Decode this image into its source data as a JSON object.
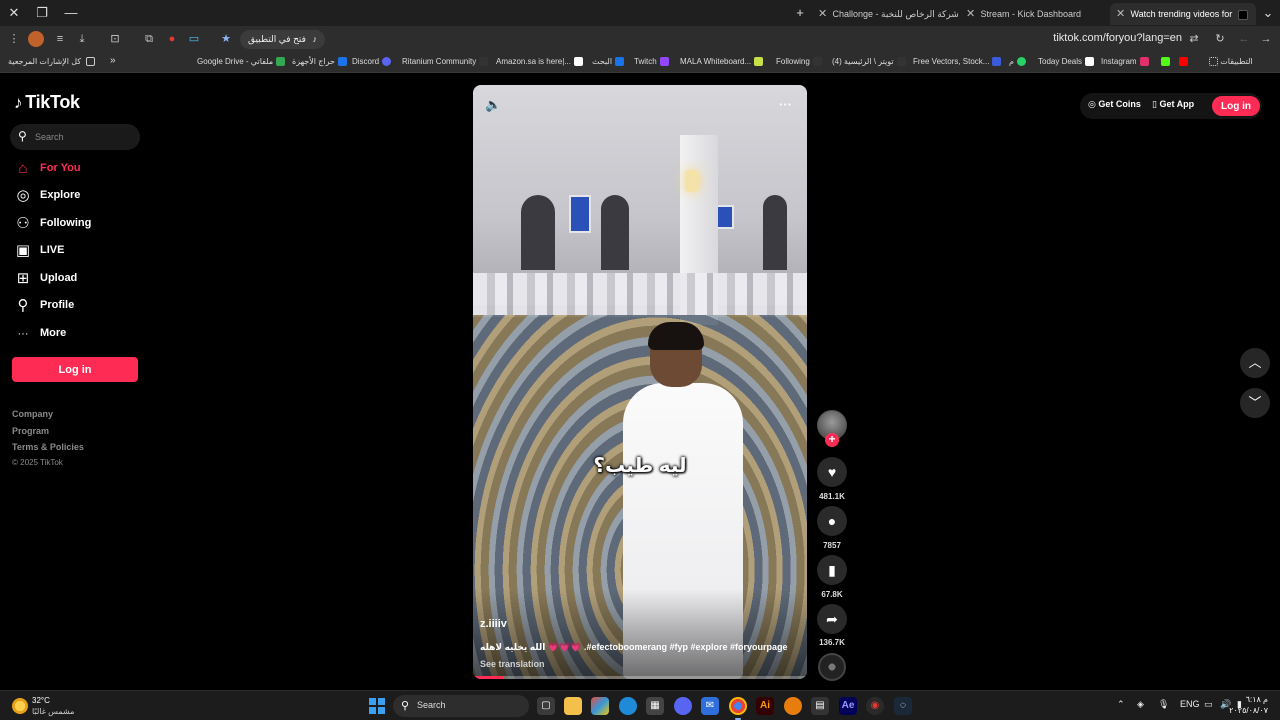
{
  "browser": {
    "tabs": [
      {
        "label": "Challonge - شركة الرخاص للنخبة"
      },
      {
        "label": "Stream - Kick Dashboard"
      },
      {
        "label": "Watch trending videos for"
      }
    ],
    "new_tab_symbol": "+",
    "open_in_app_label": "فتح في التطبيق",
    "url": "tiktok.com/foryou?lang=en",
    "all_bookmarks_label": "كل الإشارات المرجعية",
    "overflow_symbol": "»",
    "apps_label": "التطبيقات",
    "bookmarks": [
      {
        "label": "Google Drive - ملفاتي",
        "color": "#34a853"
      },
      {
        "label": "حراج الأجهزة",
        "color": "#1a73e8"
      },
      {
        "label": "Discord",
        "color": "#5865f2"
      },
      {
        "label": "Ritanium Community",
        "color": "#555555"
      },
      {
        "label": "Amazon.sa is here|...",
        "color": "#ff9900"
      },
      {
        "label": "البحث",
        "color": "#444444"
      },
      {
        "label": "Twitch",
        "color": "#9146ff"
      },
      {
        "label": "MALA Whiteboard...",
        "color": "#c8e04a"
      },
      {
        "label": "Following",
        "color": "#333333"
      },
      {
        "label": "(4) تويتر \\ الرئيسية",
        "color": "#333333"
      },
      {
        "label": "Free Vectors, Stock...",
        "color": "#3b5bdb"
      },
      {
        "label": "م",
        "color": "#25d366"
      },
      {
        "label": "Today Deals",
        "color": "#222222"
      },
      {
        "label": "Instagram",
        "color": "#e1306c"
      }
    ]
  },
  "tiktok": {
    "brand": "TikTok",
    "search_placeholder": "Search",
    "nav": [
      {
        "label": "For You",
        "icon": "home-icon",
        "glyph": "⌂",
        "active": true
      },
      {
        "label": "Explore",
        "icon": "compass-icon",
        "glyph": "◎",
        "active": false
      },
      {
        "label": "Following",
        "icon": "following-icon",
        "glyph": "⚇",
        "active": false
      },
      {
        "label": "LIVE",
        "icon": "live-icon",
        "glyph": "▣",
        "active": false
      },
      {
        "label": "Upload",
        "icon": "upload-icon",
        "glyph": "⊞",
        "active": false
      },
      {
        "label": "Profile",
        "icon": "profile-icon",
        "glyph": "⚲",
        "active": false
      },
      {
        "label": "More",
        "icon": "more-icon",
        "glyph": "···",
        "active": false
      }
    ],
    "login_label": "Log in",
    "footer_links": [
      "Company",
      "Program",
      "Terms & Policies"
    ],
    "copyright": "© 2025 TikTok",
    "top_right": {
      "coins_label": "Get Coins",
      "app_label": "Get App",
      "login_label": "Log in"
    },
    "video": {
      "overlay_caption": "ليه طيب؟",
      "username": "z.iiiiv",
      "description": "الله يخليه لاهله 💗💗💗 .#efectoboomerang #fyp #explore #foryourpage",
      "see_translation": "See translation",
      "progress": 0.09,
      "likes": "481.1K",
      "comments": "7857",
      "saves": "67.8K",
      "shares": "136.7K"
    }
  },
  "taskbar": {
    "weather_temp": "32°C",
    "weather_cond": "مشمس غالبًا",
    "search_label": "Search",
    "lang": "ENG",
    "time": "م ٦:١٨",
    "date": "٢٠٢٥/٠٨/٠٧"
  }
}
